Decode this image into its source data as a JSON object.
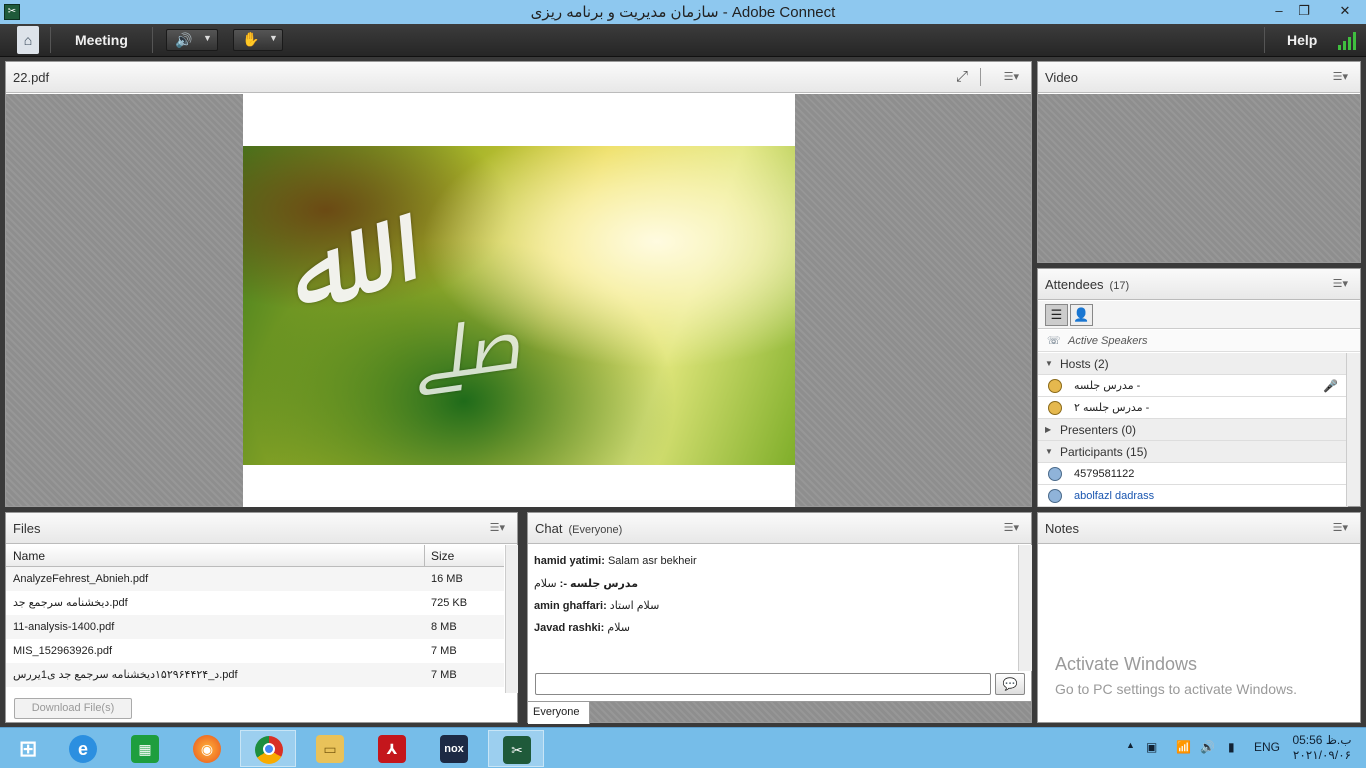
{
  "window": {
    "title": "سازمان مدیریت و برنامه ریزی - Adobe Connect",
    "controls": {
      "minimize": "–",
      "restore": "❐",
      "close": "✕"
    }
  },
  "menubar": {
    "meeting_label": "Meeting",
    "help_label": "Help"
  },
  "share_pod": {
    "title": "22.pdf"
  },
  "video_pod": {
    "title": "Video"
  },
  "attendees_pod": {
    "title": "Attendees",
    "count": "(17)",
    "active_speakers": "Active Speakers",
    "hosts_label": "Hosts (2)",
    "presenters_label": "Presenters (0)",
    "participants_label": "Participants (15)",
    "hosts": [
      "مدرس جلسه -",
      "مدرس جلسه ۲ -"
    ],
    "participants": [
      "4579581122",
      "abolfazl dadrass"
    ]
  },
  "files_pod": {
    "title": "Files",
    "col_name": "Name",
    "col_size": "Size",
    "files": [
      {
        "name": "AnalyzeFehrest_Abnieh.pdf",
        "size": "16 MB"
      },
      {
        "name": "دیخشنامه سرجمع جد.pdf",
        "size": "725 KB"
      },
      {
        "name": "11-analysis-1400.pdf",
        "size": "8 MB"
      },
      {
        "name": "MIS_152963926.pdf",
        "size": "7 MB"
      },
      {
        "name": "د_۱۵۲۹۶۴۴۲۴دیخشنامه سرجمع جد ی1یررس.pdf",
        "size": "7 MB"
      }
    ],
    "download_label": "Download File(s)"
  },
  "chat_pod": {
    "title": "Chat",
    "audience": "(Everyone)",
    "messages": [
      {
        "sender": "hamid yatimi:",
        "text": "Salam asr bekheir"
      },
      {
        "sender": "مدرس جلسه -:",
        "text": "سلام"
      },
      {
        "sender": "amin ghaffari:",
        "text": "سلام استاد"
      },
      {
        "sender": "Javad rashki:",
        "text": "سلام"
      }
    ],
    "tab_label": "Everyone"
  },
  "notes_pod": {
    "title": "Notes",
    "activate_line1": "Activate Windows",
    "activate_line2": "Go to PC settings to activate Windows."
  },
  "taskbar": {
    "language": "ENG",
    "time": "05:56 ب.ظ",
    "date": "۲۰۲۱/۰۹/۰۶",
    "apps": [
      "start-icon",
      "ie-icon",
      "store-icon",
      "firefox-icon",
      "chrome-icon",
      "explorer-icon",
      "acrobat-icon",
      "nox-icon",
      "adobe-connect-icon"
    ]
  },
  "colors": {
    "titlebar": "#8ec8ef",
    "menubar": "#2e2e2e",
    "taskbar": "#76bde9",
    "link": "#1a56b0"
  }
}
